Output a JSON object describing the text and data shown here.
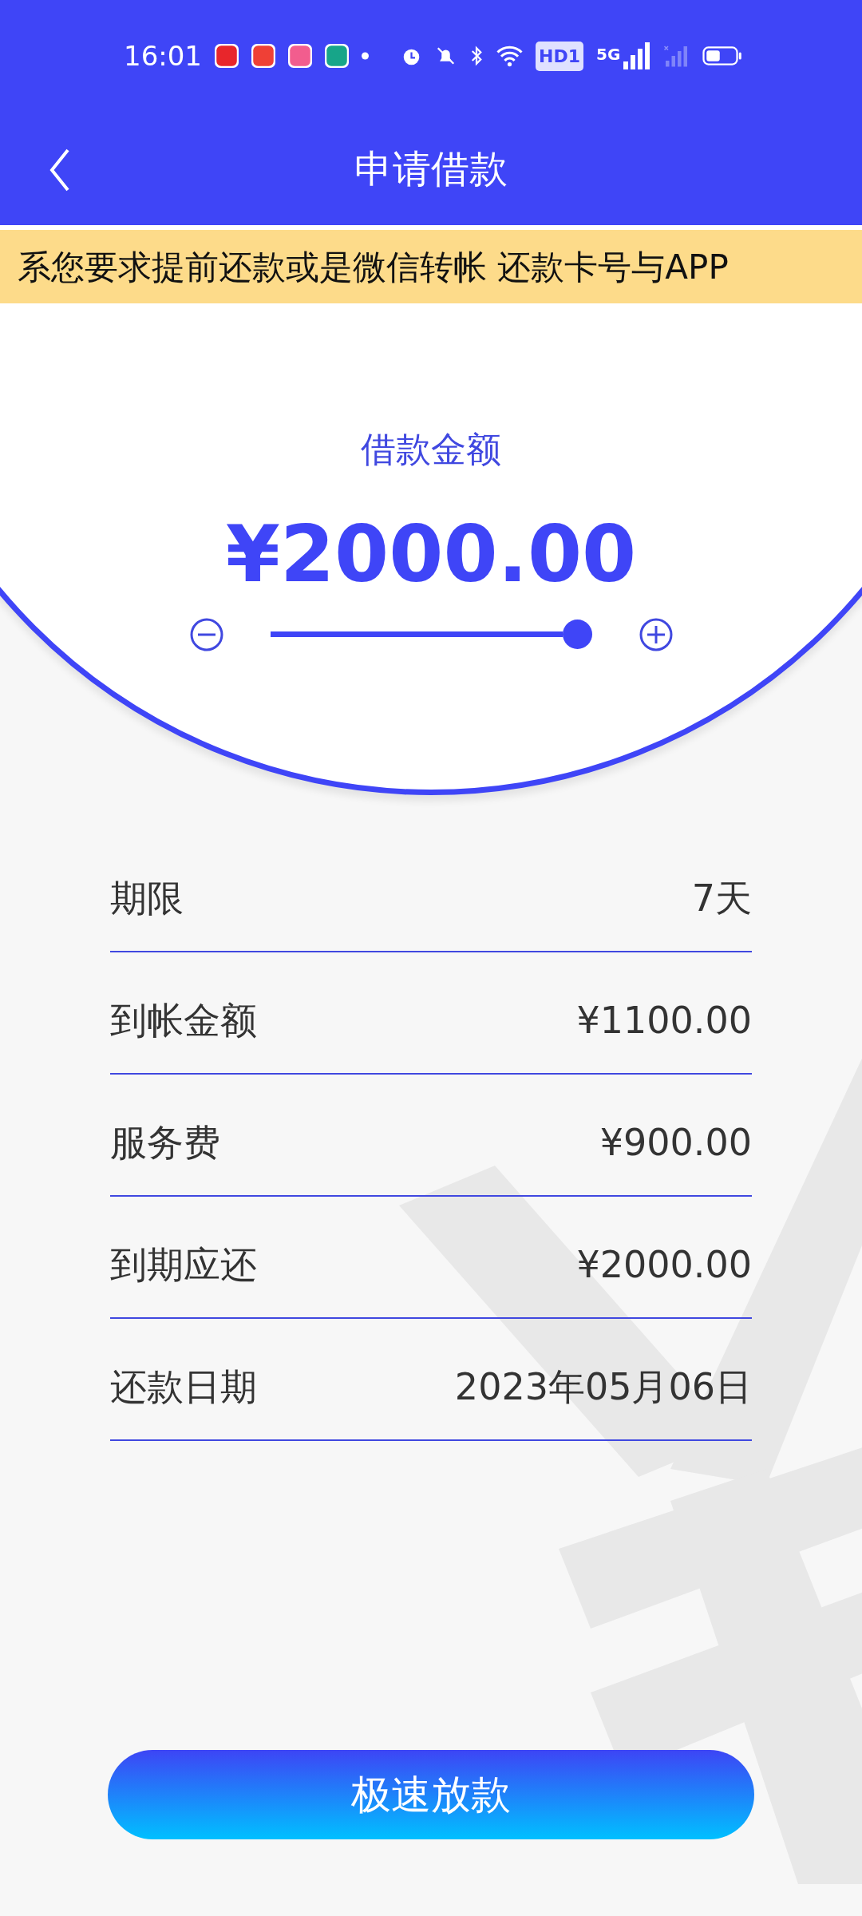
{
  "status_bar": {
    "time": "16:01",
    "hd_badge": "HD1",
    "network": "5G"
  },
  "header": {
    "title": "申请借款"
  },
  "notice": {
    "text": "系您要求提前还款或是微信转帐 还款卡号与APP"
  },
  "amount": {
    "label": "借款金额",
    "value": "¥2000.00"
  },
  "details": [
    {
      "label": "期限",
      "value": "7天"
    },
    {
      "label": "到帐金额",
      "value": "¥1100.00"
    },
    {
      "label": "服务费",
      "value": "¥900.00"
    },
    {
      "label": "到期应还",
      "value": "¥2000.00"
    },
    {
      "label": "还款日期",
      "value": "2023年05月06日"
    }
  ],
  "submit_button": {
    "label": "极速放款"
  }
}
